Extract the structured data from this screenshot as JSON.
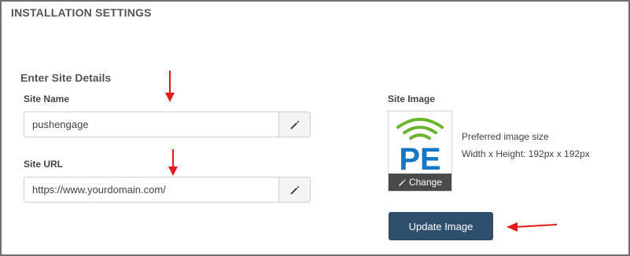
{
  "section": {
    "title": "INSTALLATION SETTINGS"
  },
  "site_details": {
    "title": "Enter Site Details",
    "site_name": {
      "label": "Site Name",
      "value": "pushengage"
    },
    "site_url": {
      "label": "Site URL",
      "value": "https://www.yourdomain.com/"
    }
  },
  "site_image": {
    "label": "Site Image",
    "logo_text": "PE",
    "change_label": "Change",
    "preferred_line1": "Preferred image size",
    "preferred_line2": "Width x Height: 192px x 192px",
    "update_button": "Update Image"
  },
  "colors": {
    "button_bg": "#2f4f6f",
    "logo_blue": "#1577c6",
    "logo_green": "#69b52e",
    "annotation_arrow": "#e21b1b"
  },
  "icons": [
    "pencil-icon",
    "wifi-signal-icon",
    "red-arrow-annotation"
  ]
}
